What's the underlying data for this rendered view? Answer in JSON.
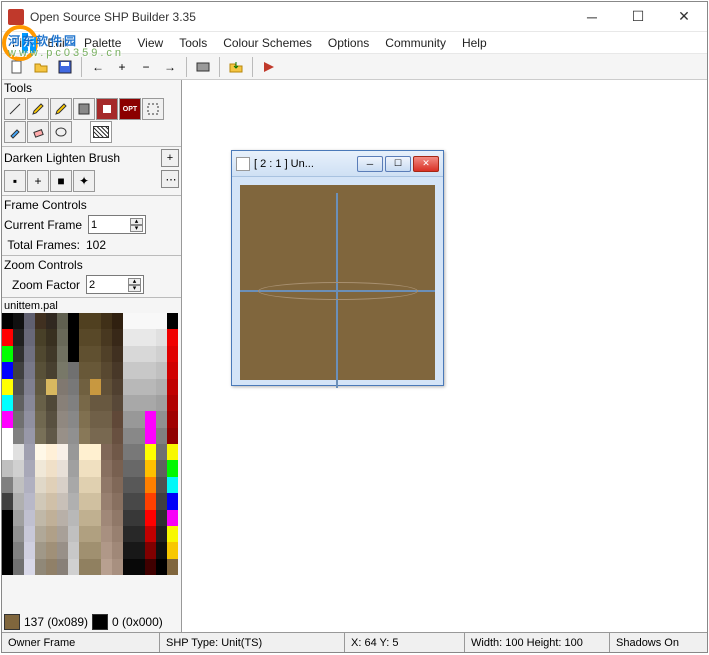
{
  "window": {
    "title": "Open Source SHP Builder 3.35"
  },
  "menu": [
    "File",
    "Edit",
    "Palette",
    "View",
    "Tools",
    "Colour Schemes",
    "Options",
    "Community",
    "Help"
  ],
  "watermark": {
    "text": "河东软件园",
    "url": "www.pc0359.cn"
  },
  "sidebar": {
    "tools_title": "Tools",
    "dlb_title": "Darken Lighten Brush",
    "frame_title": "Frame Controls",
    "current_frame_label": "Current Frame",
    "current_frame_value": "1",
    "total_frames_label": "Total Frames:",
    "total_frames_value": "102",
    "zoom_title": "Zoom Controls",
    "zoom_label": "Zoom Factor",
    "zoom_value": "2",
    "palette_name": "unittem.pal",
    "swatch1_label": "137 (0x089)",
    "swatch2_label": "0 (0x000)"
  },
  "document": {
    "title": "[ 2 : 1 ] Un..."
  },
  "status": {
    "owner": "Owner Frame",
    "shp": "SHP Type: Unit(TS)",
    "xy": "X: 64 Y: 5",
    "wh": "Width: 100 Height: 100",
    "shadow": "Shadows On"
  },
  "palette_colors": [
    "#000000",
    "#101010",
    "#606070",
    "#403020",
    "#302820",
    "#606050",
    "#000000",
    "#504020",
    "#504020",
    "#403018",
    "#302010",
    "#f8f8f8",
    "#f8f8f8",
    "#f8f8f8",
    "#f8f8f8",
    "#000000",
    "#ff0000",
    "#202020",
    "#686878",
    "#484028",
    "#383020",
    "#686858",
    "#000000",
    "#584828",
    "#584828",
    "#483820",
    "#382818",
    "#e8e8e8",
    "#e8e8e8",
    "#e8e8e8",
    "#e0e0e0",
    "#f00000",
    "#00ff00",
    "#303030",
    "#707080",
    "#504830",
    "#403828",
    "#707060",
    "#000000",
    "#605030",
    "#605030",
    "#504028",
    "#403020",
    "#d8d8d8",
    "#d8d8d8",
    "#d8d8d8",
    "#d0d0d0",
    "#e00000",
    "#0000ff",
    "#404040",
    "#787888",
    "#585038",
    "#484030",
    "#787868",
    "#707070",
    "#685838",
    "#685838",
    "#584830",
    "#483828",
    "#c8c8c8",
    "#c8c8c8",
    "#c8c8c8",
    "#c0c0c0",
    "#d00000",
    "#ffff00",
    "#505050",
    "#808090",
    "#605840",
    "#d8b860",
    "#807870",
    "#787878",
    "#706040",
    "#c89840",
    "#605038",
    "#504030",
    "#b8b8b8",
    "#b8b8b8",
    "#b8b8b8",
    "#b0b0b0",
    "#c00000",
    "#00ffff",
    "#606060",
    "#888898",
    "#686048",
    "#504838",
    "#888078",
    "#808080",
    "#786848",
    "#685840",
    "#685840",
    "#584838",
    "#a8a8a8",
    "#a8a8a8",
    "#a8a8a8",
    "#a0a0a0",
    "#b00000",
    "#ff00ff",
    "#707070",
    "#9090a0",
    "#706850",
    "#585040",
    "#908880",
    "#888888",
    "#807050",
    "#706048",
    "#706048",
    "#604838",
    "#989898",
    "#989898",
    "#ff00ff",
    "#909090",
    "#a00000",
    "#ffffff",
    "#808080",
    "#9898a8",
    "#787058",
    "#605848",
    "#989088",
    "#909090",
    "#887858",
    "#786850",
    "#786850",
    "#685040",
    "#888888",
    "#888888",
    "#ff00ff",
    "#808080",
    "#900000",
    "#ffffff",
    "#e0e0e0",
    "#a0a0b0",
    "#fff8e8",
    "#fff0d8",
    "#f8f0e8",
    "#989898",
    "#fff0d0",
    "#fff0d0",
    "#806858",
    "#705848",
    "#787878",
    "#787878",
    "#ffff00",
    "#707070",
    "#f8f800",
    "#c0c0c0",
    "#d0d0d0",
    "#a8a8b8",
    "#f0e8d8",
    "#f0e0c8",
    "#e8e0d8",
    "#a0a0a0",
    "#f0e0c0",
    "#f0e0c0",
    "#887060",
    "#786050",
    "#686868",
    "#686868",
    "#ffc000",
    "#606060",
    "#00f800",
    "#808080",
    "#c0c0c0",
    "#b0b0c0",
    "#e0d8c8",
    "#e0d0b8",
    "#d8d0c8",
    "#a8a8a8",
    "#e0d0b0",
    "#e0d0b0",
    "#907868",
    "#806858",
    "#585858",
    "#585858",
    "#ff8000",
    "#505050",
    "#00f8f8",
    "#404040",
    "#b0b0b0",
    "#b8b8c8",
    "#d0c8b8",
    "#d0c0a8",
    "#c8c0b8",
    "#b0b0b0",
    "#d0c0a0",
    "#d0c0a0",
    "#988070",
    "#887060",
    "#484848",
    "#484848",
    "#ff4000",
    "#404040",
    "#0000f8",
    "#000000",
    "#a0a0a0",
    "#c0c0d0",
    "#c0b8a8",
    "#c0b098",
    "#b8b0a8",
    "#b8b8b8",
    "#c0b090",
    "#c0b090",
    "#a08878",
    "#907868",
    "#383838",
    "#383838",
    "#ff0000",
    "#303030",
    "#f800f8",
    "#000000",
    "#909090",
    "#c8c8d8",
    "#b0a898",
    "#b0a088",
    "#a8a098",
    "#c0c0c0",
    "#b0a080",
    "#b0a080",
    "#a89080",
    "#988070",
    "#282828",
    "#282828",
    "#c00000",
    "#202020",
    "#f8f800",
    "#000000",
    "#808080",
    "#d0d0e0",
    "#a09888",
    "#a09078",
    "#989088",
    "#c8c8c8",
    "#a09070",
    "#a09070",
    "#b09888",
    "#a08878",
    "#181818",
    "#181818",
    "#800000",
    "#101010",
    "#f8c800",
    "#000000",
    "#707070",
    "#d8d8e8",
    "#908878",
    "#908068",
    "#888078",
    "#d0d0d0",
    "#908060",
    "#908060",
    "#b8a090",
    "#a89080",
    "#080808",
    "#080808",
    "#400000",
    "#000000",
    "#80663d"
  ]
}
